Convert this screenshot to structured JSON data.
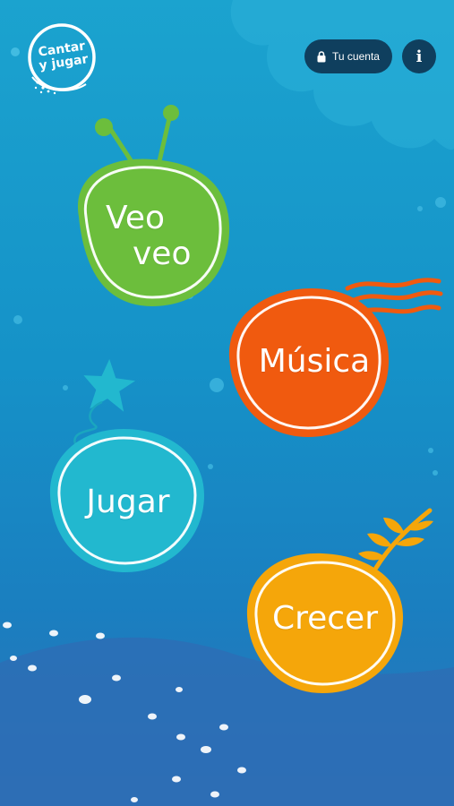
{
  "app": {
    "logo_line1": "Cantar",
    "logo_line2": "y jugar"
  },
  "header": {
    "account_label": "Tu cuenta",
    "account_icon": "lock-icon",
    "info_icon": "info-icon",
    "info_glyph": "i"
  },
  "menu": {
    "items": [
      {
        "id": "veo-veo",
        "line1": "Veo",
        "line2": "veo",
        "color": "#6cbe3c",
        "decoration": "antenna"
      },
      {
        "id": "musica",
        "label": "Música",
        "color": "#f05a0f",
        "decoration": "waves"
      },
      {
        "id": "jugar",
        "label": "Jugar",
        "color": "#22b8cf",
        "decoration": "star"
      },
      {
        "id": "crecer",
        "label": "Crecer",
        "color": "#f5a60a",
        "decoration": "leaf"
      }
    ]
  },
  "colors": {
    "background_top": "#1ba3cf",
    "background_bottom": "#2a72b8",
    "button_dark": "#0f3f5e"
  }
}
